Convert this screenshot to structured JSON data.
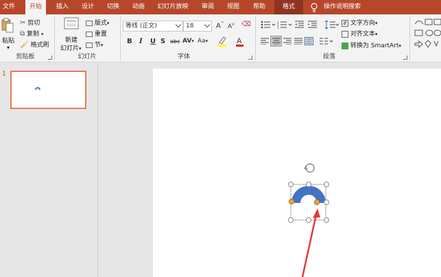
{
  "tabs": [
    "文件",
    "开始",
    "插入",
    "设计",
    "切换",
    "动画",
    "幻灯片放映",
    "审阅",
    "视图",
    "帮助",
    "格式"
  ],
  "tell_me": "操作说明搜索",
  "clipboard": {
    "paste": "粘贴",
    "cut": "剪切",
    "copy": "复制",
    "format_painter": "格式刷",
    "group": "剪贴板"
  },
  "slides_group": {
    "new_slide_line1": "新建",
    "new_slide_line2": "幻灯片",
    "layout": "版式",
    "reset": "重置",
    "section": "节",
    "group": "幻灯片"
  },
  "font": {
    "name": "等线 (正文)",
    "size": "18",
    "bold": "B",
    "italic": "I",
    "underline": "U",
    "shadow": "S",
    "strike": "abc",
    "spacing": "AV",
    "case": "Aa",
    "group": "字体"
  },
  "paragraph": {
    "text_direction": "文字方向",
    "align_text": "对齐文本",
    "convert_smartart": "转换为 SmartArt",
    "group": "段落"
  },
  "slide_panel": {
    "number": "1"
  },
  "colors": {
    "accent": "#b7472a",
    "shape": "#4472c4",
    "handle": "#e8a33a",
    "arrow": "#e23b3b"
  }
}
